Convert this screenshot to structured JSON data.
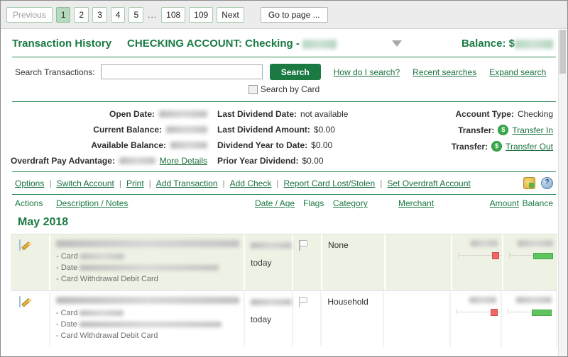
{
  "pagination": {
    "previous_label": "Previous",
    "pages": [
      "1",
      "2",
      "3",
      "4",
      "5"
    ],
    "ellipsis": "...",
    "tail_pages": [
      "108",
      "109"
    ],
    "next_label": "Next",
    "goto_label": "Go to page ...",
    "active_page": "1"
  },
  "account_header": {
    "section_title": "Transaction History",
    "account_label": "CHECKING ACCOUNT: Checking -",
    "account_number_redacted": "",
    "dropdown_icon": "chevron-down-icon",
    "balance_label": "Balance: $",
    "balance_value_redacted": ""
  },
  "search": {
    "label": "Search Transactions:",
    "value": "",
    "placeholder": "",
    "button_label": "Search",
    "links": [
      "How do I search?",
      "Recent searches",
      "Expand search"
    ],
    "by_card_label": "Search by Card",
    "by_card_checked": false
  },
  "details": {
    "col1": [
      {
        "label": "Open Date:",
        "value": "",
        "redacted": true
      },
      {
        "label": "Current Balance:",
        "value": "",
        "redacted": true
      },
      {
        "label": "Available Balance:",
        "value": "",
        "redacted": true
      },
      {
        "label": "Overdraft Pay Advantage:",
        "value": "",
        "redacted": true,
        "link": "More Details"
      }
    ],
    "col2": [
      {
        "label": "Last Dividend Date:",
        "value": "not available"
      },
      {
        "label": "Last Dividend Amount:",
        "value": "$0.00"
      },
      {
        "label": "Dividend Year to Date:",
        "value": "$0.00"
      },
      {
        "label": "Prior Year Dividend:",
        "value": "$0.00"
      }
    ],
    "col3": [
      {
        "label": "Account Type:",
        "value": "Checking"
      },
      {
        "label": "Transfer:",
        "link": "Transfer In",
        "icon": "dollar-coin-icon"
      },
      {
        "label": "Transfer:",
        "link": "Transfer Out",
        "icon": "dollar-coin-icon"
      }
    ]
  },
  "action_links": [
    "Options",
    "Switch Account",
    "Print",
    "Add Transaction",
    "Add Check",
    "Report Card Lost/Stolen",
    "Set Overdraft Account"
  ],
  "action_icons": [
    "export-package-icon",
    "help-icon"
  ],
  "table": {
    "headers": {
      "actions": "Actions",
      "description": "Description / Notes",
      "date": "Date / Age",
      "flags": "Flags",
      "category": "Category",
      "merchant": "Merchant",
      "amount": "Amount",
      "balance": "Balance"
    },
    "month_group": "May 2018",
    "rows": [
      {
        "action_icon": "edit-icon",
        "description_redacted": true,
        "notes": [
          {
            "prefix": "- Card",
            "redacted": true
          },
          {
            "prefix": "- Date",
            "redacted": true
          },
          {
            "prefix": "- Card Withdrawal Debit Card",
            "redacted": false
          }
        ],
        "date_redacted": true,
        "age": "today",
        "flag_icon": "flag-icon",
        "category": "None",
        "merchant_badge": "green",
        "amount_redacted": true,
        "amount_bar": "debit",
        "balance_redacted": true,
        "balance_bar": "credit"
      },
      {
        "action_icon": "edit-icon",
        "description_redacted": true,
        "notes": [
          {
            "prefix": "- Card",
            "redacted": true
          },
          {
            "prefix": "- Date",
            "redacted": true
          },
          {
            "prefix": "- Card Withdrawal Debit Card",
            "redacted": false
          }
        ],
        "date_redacted": true,
        "age": "today",
        "flag_icon": "flag-icon",
        "category": "Household",
        "merchant_badge": "white",
        "amount_redacted": true,
        "amount_bar": "debit",
        "balance_redacted": true,
        "balance_bar": "credit"
      }
    ]
  },
  "colors": {
    "brand_green": "#1a7a42",
    "link_green": "#1a6f3e",
    "row_tint": "#eef2e4",
    "pager_bg": "#ececec",
    "debit_marker": "#ef6767",
    "credit_marker": "#5fc45f"
  }
}
